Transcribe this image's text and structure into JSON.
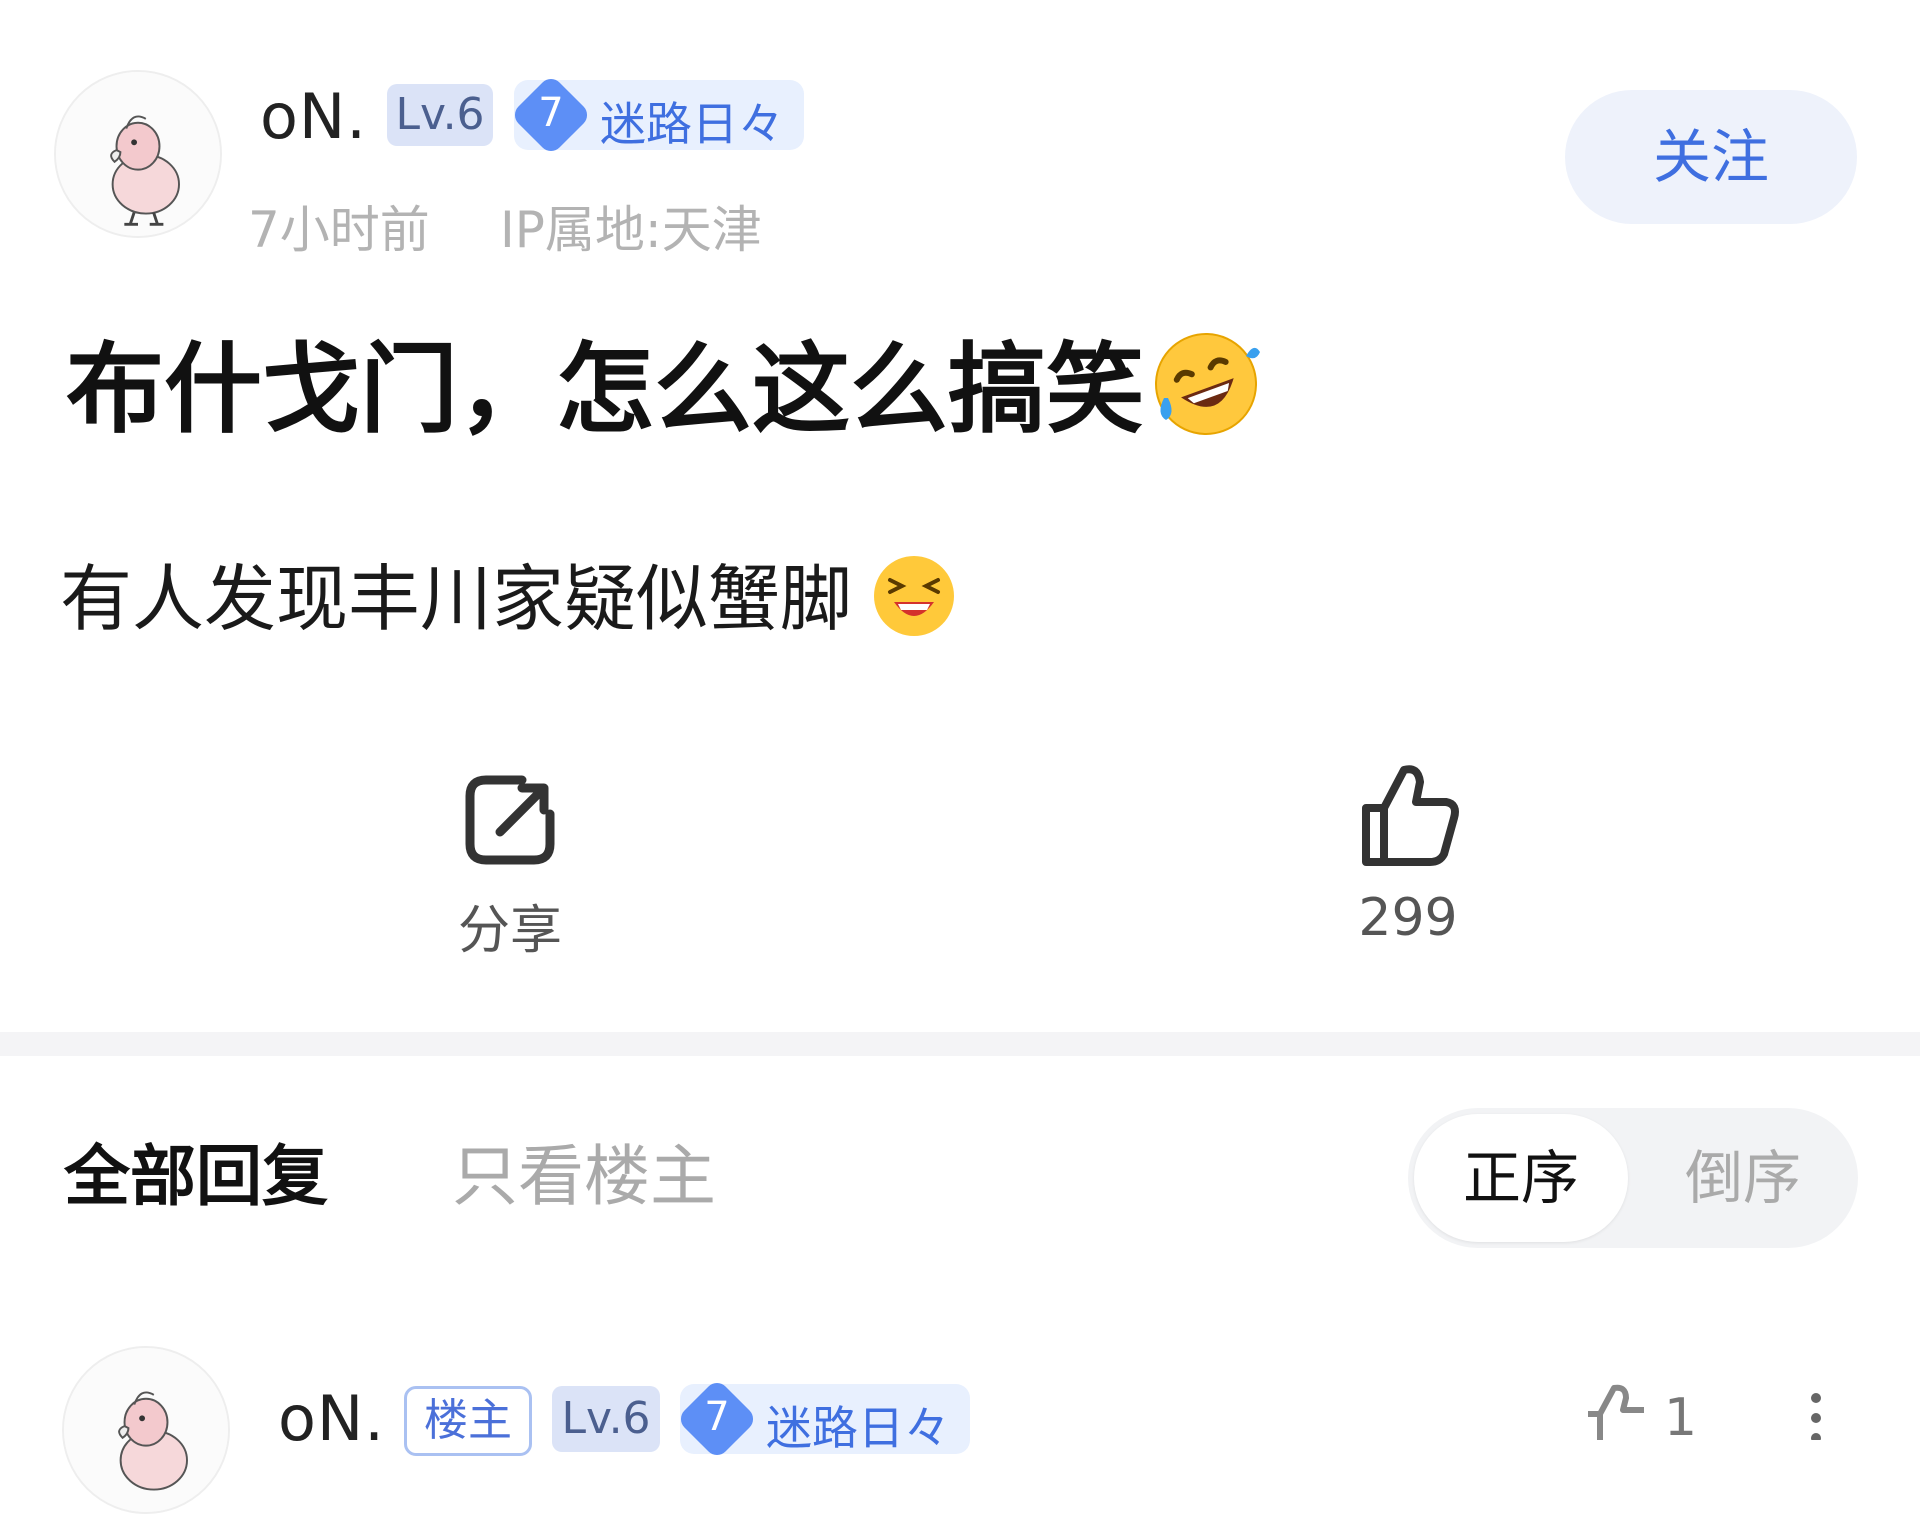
{
  "post": {
    "author": {
      "name": "oN.",
      "level": "Lv.6",
      "tag_number": "7",
      "tag_text": "迷路日々"
    },
    "time": "7小时前",
    "ip": "IP属地:天津",
    "follow_label": "关注",
    "title": "布什戈门，怎么这么搞笑",
    "title_emoji": "rofl-emoji",
    "body": "有人发现丰川家疑似蟹脚",
    "body_emoji": "laughing-emoji",
    "share_label": "分享",
    "like_count": "299"
  },
  "replies": {
    "tab_all": "全部回复",
    "tab_owner_only": "只看楼主",
    "sort_asc": "正序",
    "sort_desc": "倒序",
    "first_reply": {
      "name": "oN.",
      "owner_badge": "楼主",
      "level": "Lv.6",
      "tag_number": "7",
      "tag_text": "迷路日々",
      "like_count": "1"
    }
  },
  "colors": {
    "accent": "#3f6fe0",
    "tag_bg": "#e8f0fe",
    "level_bg": "#dbe3f7"
  }
}
